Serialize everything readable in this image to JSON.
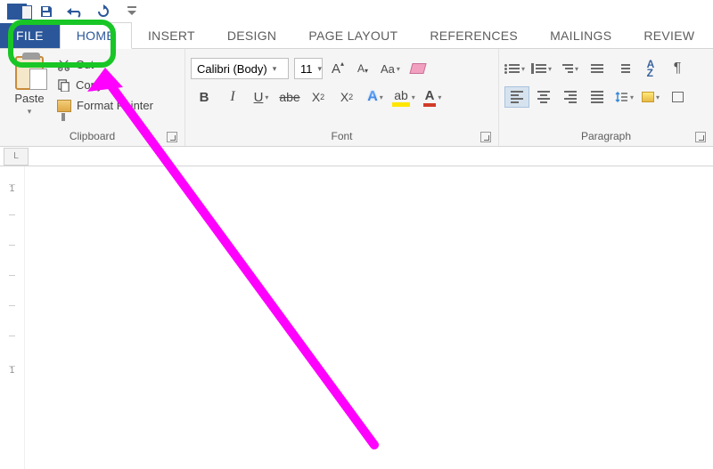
{
  "quickAccess": {
    "save": "save-icon",
    "undo": "undo-icon",
    "redo": "redo-icon"
  },
  "tabs": {
    "file": "FILE",
    "home": "HOME",
    "insert": "INSERT",
    "design": "DESIGN",
    "pageLayout": "PAGE LAYOUT",
    "references": "REFERENCES",
    "mailings": "MAILINGS",
    "review": "REVIEW"
  },
  "clipboard": {
    "groupLabel": "Clipboard",
    "paste": "Paste",
    "cut": "Cut",
    "copy": "Copy",
    "formatPainter": "Format Painter"
  },
  "font": {
    "groupLabel": "Font",
    "name": "Calibri (Body)",
    "size": "11"
  },
  "paragraph": {
    "groupLabel": "Paragraph"
  },
  "ruler": {
    "corner": "L",
    "vticks": [
      "1",
      "",
      "",
      "",
      "",
      "",
      "1"
    ]
  }
}
